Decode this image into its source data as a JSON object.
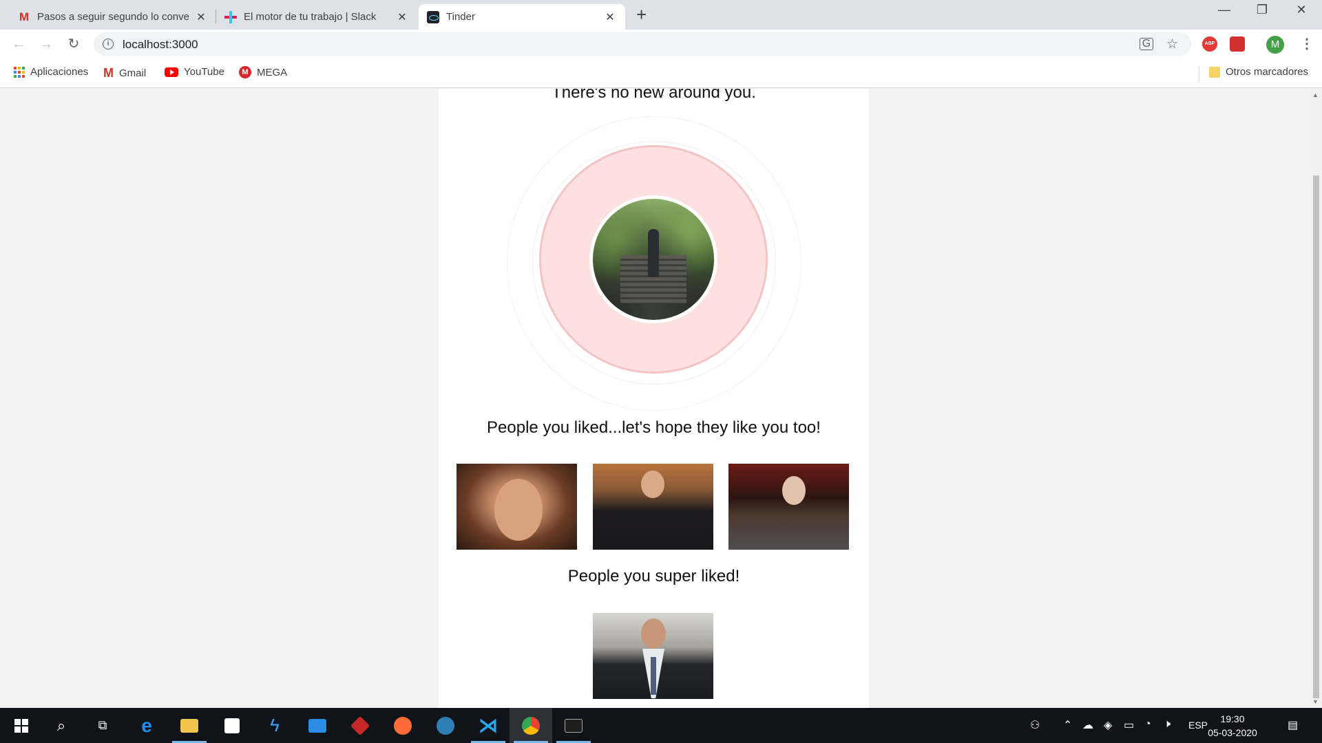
{
  "browser": {
    "tabs": [
      {
        "title": "Pasos a seguir segundo lo conve",
        "icon": "gmail-icon",
        "active": false
      },
      {
        "title": "El motor de tu trabajo | Slack",
        "icon": "slack-icon",
        "active": false
      },
      {
        "title": "Tinder",
        "icon": "react-icon",
        "active": true
      }
    ],
    "new_tab_glyph": "+",
    "close_glyph": "✕",
    "window_controls": {
      "minimize": "—",
      "restore": "❐",
      "close": "✕"
    },
    "nav": {
      "back": "←",
      "forward": "→",
      "reload": "↻"
    },
    "address": "localhost:3000",
    "profile_initial": "M",
    "bookmarks": [
      {
        "label": "Aplicaciones",
        "icon": "apps-grid-icon"
      },
      {
        "label": "Gmail",
        "icon": "gmail-icon"
      },
      {
        "label": "YouTube",
        "icon": "youtube-icon"
      },
      {
        "label": "MEGA",
        "icon": "mega-icon"
      }
    ],
    "other_bookmarks": "Otros marcadores",
    "accent_color": "#1a73e8"
  },
  "page": {
    "no_new_text": "There's no new around you.",
    "liked_heading": "People you liked...let's hope they like you too!",
    "liked_count": 3,
    "super_liked_heading": "People you super liked!",
    "super_liked_count": 1,
    "radar_color": "#fde1e1"
  },
  "taskbar": {
    "apps": [
      "start-icon",
      "search-icon",
      "task-view-icon",
      "edge-icon",
      "file-explorer-icon",
      "store-icon",
      "vs-icon",
      "mail-icon",
      "app-icon",
      "postman-icon",
      "xampp-icon",
      "vscode-icon",
      "chrome-icon",
      "terminal-icon"
    ],
    "language": "ESP",
    "time": "19:30",
    "date": "05-03-2020"
  }
}
